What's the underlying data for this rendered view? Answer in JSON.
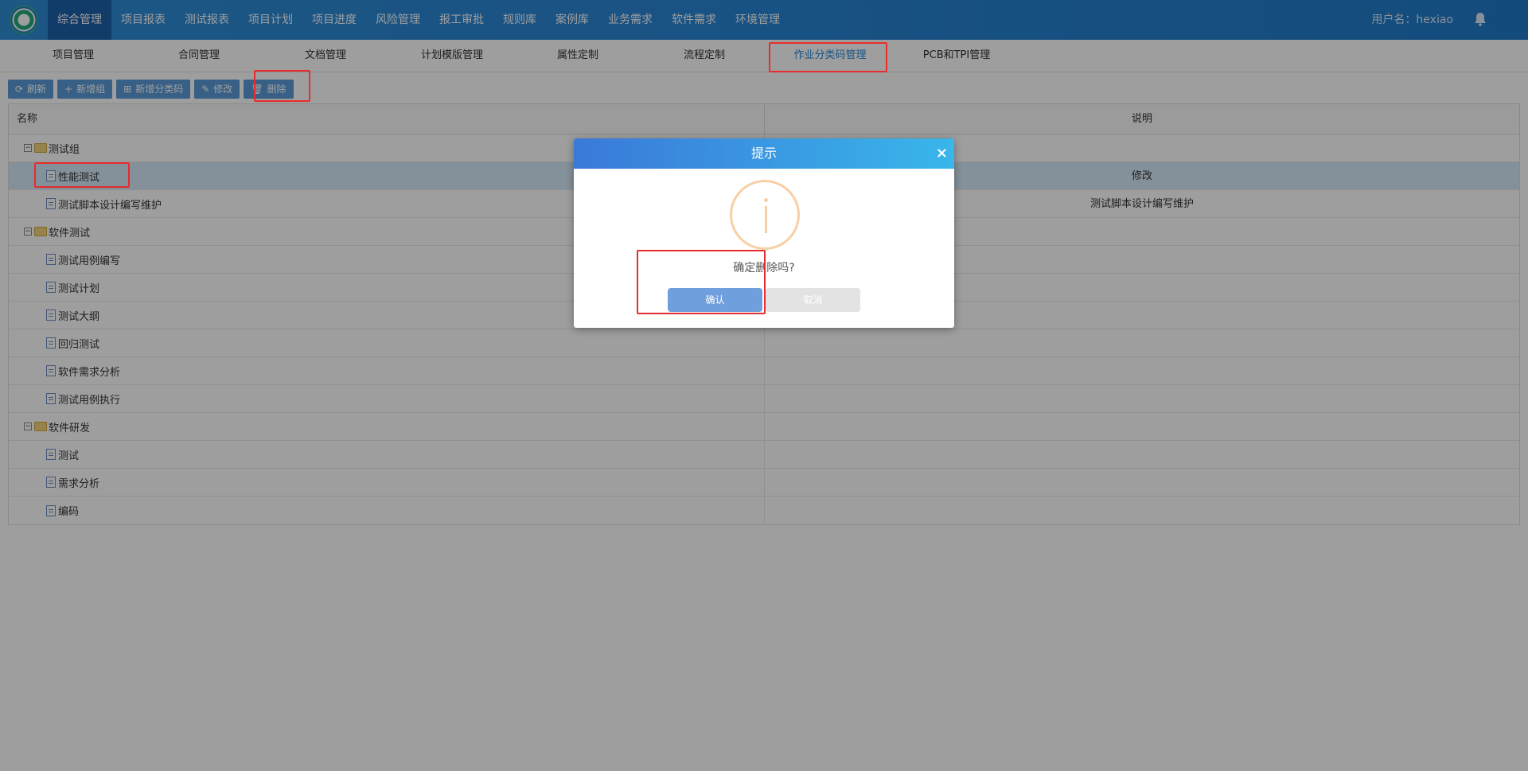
{
  "topnav": {
    "items": [
      "综合管理",
      "项目报表",
      "测试报表",
      "项目计划",
      "项目进度",
      "风险管理",
      "报工审批",
      "规则库",
      "案例库",
      "业务需求",
      "软件需求",
      "环境管理"
    ],
    "active_index": 0,
    "user_label": "用户名：hexiao",
    "bell_icon": "bell-icon",
    "logo_icon": "swirl-logo"
  },
  "subnav": {
    "items": [
      "项目管理",
      "合同管理",
      "文档管理",
      "计划模版管理",
      "属性定制",
      "流程定制",
      "作业分类码管理",
      "PCB和TPI管理"
    ],
    "active_index": 6
  },
  "toolbar": {
    "refresh": "刷新",
    "add_group": "新增组",
    "add_code": "新增分类码",
    "edit": "修改",
    "delete": "删除"
  },
  "grid": {
    "header_name": "名称",
    "header_desc": "说明",
    "rows": [
      {
        "name": "测试组",
        "desc": "",
        "type": "group"
      },
      {
        "name": "性能测试",
        "desc": "修改",
        "type": "item",
        "selected": true
      },
      {
        "name": "测试脚本设计编写维护",
        "desc": "测试脚本设计编写维护",
        "type": "item"
      },
      {
        "name": "软件测试",
        "desc": "",
        "type": "group"
      },
      {
        "name": "测试用例编写",
        "desc": "",
        "type": "item"
      },
      {
        "name": "测试计划",
        "desc": "",
        "type": "item"
      },
      {
        "name": "测试大纲",
        "desc": "",
        "type": "item"
      },
      {
        "name": "回归测试",
        "desc": "",
        "type": "item"
      },
      {
        "name": "软件需求分析",
        "desc": "",
        "type": "item"
      },
      {
        "name": "测试用例执行",
        "desc": "",
        "type": "item"
      },
      {
        "name": "软件研发",
        "desc": "",
        "type": "group"
      },
      {
        "name": "测试",
        "desc": "",
        "type": "item"
      },
      {
        "name": "需求分析",
        "desc": "",
        "type": "item"
      },
      {
        "name": "编码",
        "desc": "",
        "type": "item"
      }
    ]
  },
  "dialog": {
    "title": "提示",
    "close": "×",
    "message": "确定删除吗?",
    "confirm": "确认",
    "cancel": "取消",
    "icon": "info-icon"
  },
  "colors": {
    "nav_bg": "#2a86d6",
    "nav_active": "#1c5fa8",
    "button": "#5b9bd9",
    "highlight": "#e62c2c"
  }
}
